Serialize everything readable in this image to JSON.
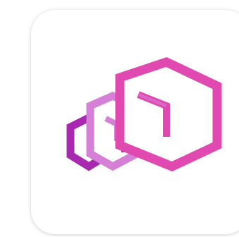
{
  "app_icon": {
    "icon_name": "stacked-hexagon-cubes-icon",
    "colors": {
      "tile_background": "#ffffff",
      "front_hexagon": "#e04ab0",
      "middle_hexagon": "#d67fd6",
      "back_hexagon": "#a828b0"
    }
  }
}
